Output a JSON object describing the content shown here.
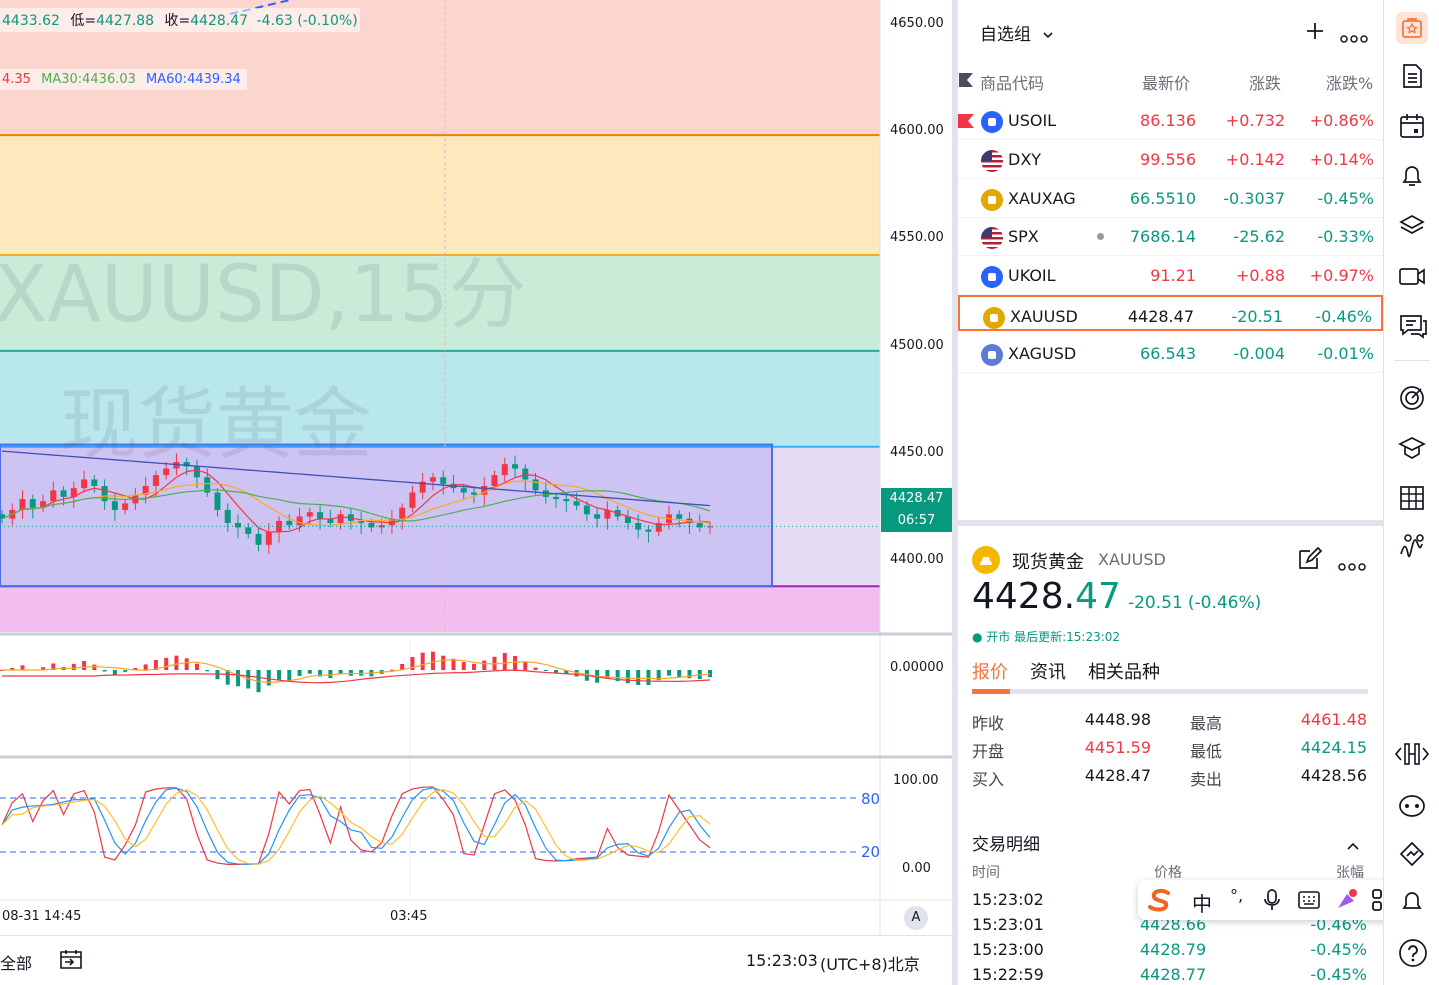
{
  "chart": {
    "symbol_watermark": "XAUUSD,15分",
    "name_watermark": "现货黄金",
    "legend_ohlc": {
      "prefix": "4433.62",
      "low_label": "低=",
      "low": "4427.88",
      "close_label": "收=",
      "close": "4428.47",
      "change": "-4.63 (-0.10%)"
    },
    "legend_ma": {
      "ma_partial": "4.35",
      "ma30": "MA30:4436.03",
      "ma60": "MA60:4439.34"
    },
    "price_axis": [
      "4650.00",
      "4600.00",
      "4550.00",
      "4500.00",
      "4450.00",
      "4400.00"
    ],
    "last_price": "4428.47",
    "countdown": "06:57",
    "macd_axis": "0.00000",
    "stoch_axis_top": "100.00",
    "stoch_axis_bottom": "0.00",
    "stoch_level_80": "80",
    "stoch_level_20": "20",
    "time_axis": [
      "08-31 14:45",
      "03:45"
    ],
    "auto_scale": "A",
    "bottom_range": "全部",
    "clock": "15:23:03",
    "timezone": "(UTC+8)北京"
  },
  "chart_data": {
    "type": "candlestick",
    "title": "XAUUSD,15分",
    "y_range": [
      4380,
      4670
    ],
    "zones": [
      {
        "from": 4608,
        "to": 4670,
        "color": "#fdd5cf"
      },
      {
        "from": 4553,
        "to": 4608,
        "color": "#fde9bd"
      },
      {
        "from": 4509,
        "to": 4553,
        "color": "#c8ecd8"
      },
      {
        "from": 4465,
        "to": 4509,
        "color": "#b8e7ee"
      },
      {
        "from": 4401,
        "to": 4465,
        "color": "#e6dcf6"
      },
      {
        "from": 4380,
        "to": 4401,
        "color": "#f3bdf0"
      }
    ],
    "range_box": {
      "high": 4466,
      "low": 4401
    },
    "closes": [
      4432,
      4436,
      4441,
      4437,
      4440,
      4445,
      4442,
      4446,
      4450,
      4447,
      4440,
      4436,
      4439,
      4443,
      4447,
      4452,
      4455,
      4458,
      4456,
      4451,
      4444,
      4436,
      4430,
      4428,
      4425,
      4420,
      4426,
      4431,
      4429,
      4433,
      4435,
      4432,
      4430,
      4434,
      4431,
      4430,
      4428,
      4429,
      4432,
      4437,
      4444,
      4449,
      4451,
      4448,
      4446,
      4444,
      4443,
      4447,
      4452,
      4457,
      4455,
      4450,
      4445,
      4442,
      4441,
      4440,
      4438,
      4434,
      4432,
      4436,
      4433,
      4430,
      4427,
      4426,
      4430,
      4434,
      4432,
      4430,
      4428,
      4428.47
    ],
    "ma30": 4436.03,
    "ma60": 4439.34,
    "last": 4428.47
  },
  "watchlist": {
    "title": "自选组",
    "col_symbol": "商品代码",
    "col_last": "最新价",
    "col_chg": "涨跌",
    "col_chgp": "涨跌%",
    "rows": [
      {
        "symbol": "USOIL",
        "last": "86.136",
        "chg": "+0.732",
        "chgp": "+0.86%",
        "dir": "up",
        "icon": "oil-icon",
        "icon_color": "#2962ff",
        "flag": true
      },
      {
        "symbol": "DXY",
        "last": "99.556",
        "chg": "+0.142",
        "chgp": "+0.14%",
        "dir": "up",
        "icon": "us-flag-icon",
        "icon_color": "#b22234",
        "flag": false
      },
      {
        "symbol": "XAUXAG",
        "last": "66.5510",
        "chg": "-0.3037",
        "chgp": "-0.45%",
        "dir": "dn",
        "icon": "gold-silver-icon",
        "icon_color": "#e0a800",
        "flag": false
      },
      {
        "symbol": "SPX",
        "last": "7686.14",
        "chg": "-25.62",
        "chgp": "-0.33%",
        "dir": "dn",
        "icon": "us-flag-icon",
        "icon_color": "#b22234",
        "flag": false,
        "dot": true
      },
      {
        "symbol": "UKOIL",
        "last": "91.21",
        "chg": "+0.88",
        "chgp": "+0.97%",
        "dir": "up",
        "icon": "oil-icon",
        "icon_color": "#2962ff",
        "flag": false
      },
      {
        "symbol": "XAUUSD",
        "last": "4428.47",
        "chg": "-20.51",
        "chgp": "-0.46%",
        "dir": "dn",
        "icon": "gold-icon",
        "icon_color": "#e0a800",
        "flag": false,
        "selected": true
      },
      {
        "symbol": "XAGUSD",
        "last": "66.543",
        "chg": "-0.004",
        "chgp": "-0.01%",
        "dir": "dn",
        "icon": "silver-icon",
        "icon_color": "#5b7bd5",
        "flag": false
      }
    ]
  },
  "detail": {
    "name": "现货黄金",
    "symbol": "XAUUSD",
    "price_main": "4428.",
    "price_frac": "47",
    "change": "-20.51",
    "change_pct": "(-0.46%)",
    "status": "● 开市 最后更新:15:23:02",
    "tabs": [
      "报价",
      "资讯",
      "相关品种"
    ],
    "stats": [
      {
        "l1": "昨收",
        "v1": "4448.98",
        "c1": "#131722",
        "l2": "最高",
        "v2": "4461.48",
        "c2": "#f23645"
      },
      {
        "l1": "开盘",
        "v1": "4451.59",
        "c1": "#f23645",
        "l2": "最低",
        "v2": "4424.15",
        "c2": "#089981"
      },
      {
        "l1": "买入",
        "v1": "4428.47",
        "c1": "#131722",
        "l2": "卖出",
        "v2": "4428.56",
        "c2": "#131722"
      }
    ],
    "trades_title": "交易明细",
    "trades_cols": [
      "时间",
      "价格",
      "张幅"
    ],
    "trades": [
      {
        "t": "15:23:02",
        "p": "",
        "c": ""
      },
      {
        "t": "15:23:01",
        "p": "4428.66",
        "c": "-0.46%"
      },
      {
        "t": "15:23:00",
        "p": "4428.79",
        "c": "-0.45%"
      },
      {
        "t": "15:22:59",
        "p": "4428.77",
        "c": "-0.45%"
      }
    ]
  },
  "ime": {
    "zh": "中",
    "punct": "°,"
  },
  "colors": {
    "up": "#f23645",
    "down": "#089981",
    "accent": "#f7743b",
    "blue": "#2962ff"
  }
}
